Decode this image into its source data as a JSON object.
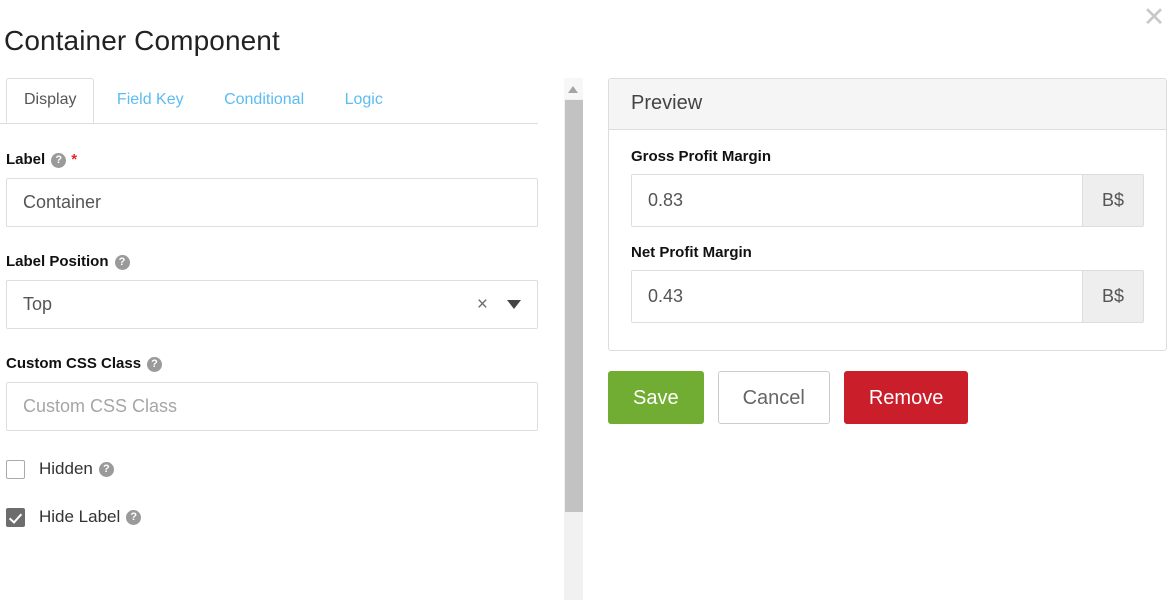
{
  "modal": {
    "title": "Container Component",
    "close_label": "✕"
  },
  "tabs": [
    {
      "label": "Display",
      "active": true
    },
    {
      "label": "Field Key",
      "active": false
    },
    {
      "label": "Conditional",
      "active": false
    },
    {
      "label": "Logic",
      "active": false
    }
  ],
  "settings": {
    "label_field": {
      "label": "Label",
      "help": "?",
      "required_marker": "*",
      "value": "Container",
      "placeholder": "Label"
    },
    "label_position": {
      "label": "Label Position",
      "help": "?",
      "value": "Top",
      "clear_icon": "×"
    },
    "custom_css": {
      "label": "Custom CSS Class",
      "help": "?",
      "value": "",
      "placeholder": "Custom CSS Class"
    },
    "hidden": {
      "label": "Hidden",
      "help": "?",
      "checked": false
    },
    "hide_label": {
      "label": "Hide Label",
      "help": "?",
      "checked": true
    }
  },
  "preview": {
    "title": "Preview",
    "fields": [
      {
        "label": "Gross Profit Margin",
        "value": "0.83",
        "addon": "B$"
      },
      {
        "label": "Net Profit Margin",
        "value": "0.43",
        "addon": "B$"
      }
    ]
  },
  "actions": {
    "save": "Save",
    "cancel": "Cancel",
    "remove": "Remove"
  },
  "colors": {
    "tab_link": "#5bbcf2",
    "save_green": "#70ad32",
    "remove_red": "#ca1f2b",
    "required_red": "#e8252b",
    "panel_border": "#dddddd",
    "checkbox_checked": "#6d6d6d"
  }
}
